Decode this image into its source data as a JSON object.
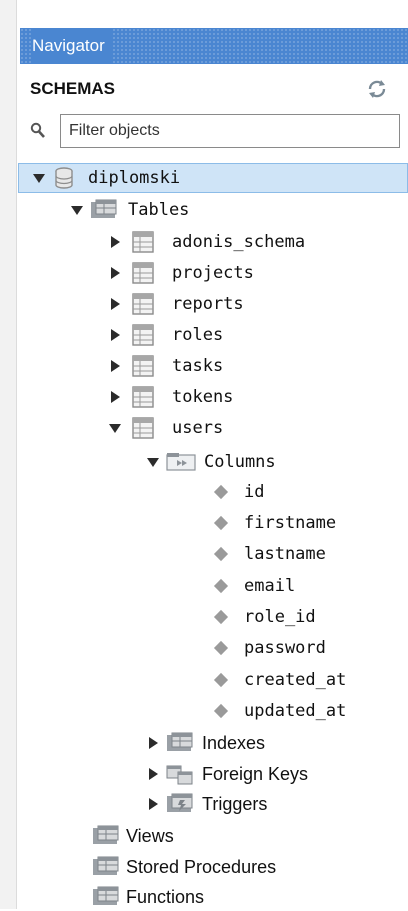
{
  "navigator": {
    "title": "Navigator"
  },
  "schemas": {
    "title": "SCHEMAS"
  },
  "filter": {
    "placeholder": "Filter objects",
    "value": ""
  },
  "tree": {
    "schema": {
      "name": "diplomski"
    },
    "tables_label": "Tables",
    "tables": [
      "adonis_schema",
      "projects",
      "reports",
      "roles",
      "tasks",
      "tokens",
      "users"
    ],
    "columns_label": "Columns",
    "columns": [
      "id",
      "firstname",
      "lastname",
      "email",
      "role_id",
      "password",
      "created_at",
      "updated_at"
    ],
    "indexes_label": "Indexes",
    "foreign_keys_label": "Foreign Keys",
    "triggers_label": "Triggers",
    "views_label": "Views",
    "stored_procedures_label": "Stored Procedures",
    "functions_label": "Functions"
  },
  "colors": {
    "header": "#4a86d1",
    "selection": "#cfe4f7",
    "selection_border": "#8cbce8",
    "expander": "#2b2b2b"
  },
  "icons": {
    "refresh": "refresh-icon",
    "search": "search-icon",
    "database": "database-icon",
    "folder": "folder-icon",
    "table": "table-icon",
    "column": "column-icon"
  }
}
